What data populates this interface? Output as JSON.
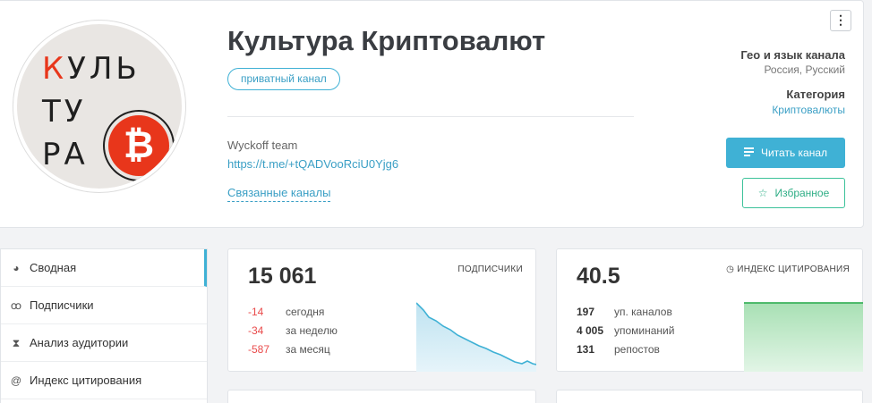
{
  "channel": {
    "title": "Культура Криптовалют",
    "badge": "приватный канал",
    "description": "Wyckoff team",
    "link": "https://t.me/+tQADVooRciU0Yjg6",
    "related": "Связанные каналы",
    "logo_lines": [
      "КУЛЬ",
      "ТУ",
      "РА"
    ],
    "logo_coin_symbol": "₿"
  },
  "info": {
    "geo_label": "Гео и язык канала",
    "geo_value": "Россия, Русский",
    "category_label": "Категория",
    "category_value": "Криптовалюты"
  },
  "buttons": {
    "read": "Читать канал",
    "favorite": "Избранное",
    "menu": "⋮"
  },
  "sidebar": {
    "items": [
      {
        "label": "Сводная",
        "icon": "dashboard-icon"
      },
      {
        "label": "Подписчики",
        "icon": "users-icon"
      },
      {
        "label": "Анализ аудитории",
        "icon": "hourglass-icon"
      },
      {
        "label": "Индекс цитирования",
        "icon": "at-icon"
      }
    ]
  },
  "subscribers": {
    "total": "15 061",
    "label": "ПОДПИСЧИКИ",
    "rows": [
      {
        "value": "-14",
        "label": "сегодня"
      },
      {
        "value": "-34",
        "label": "за неделю"
      },
      {
        "value": "-587",
        "label": "за месяц"
      }
    ]
  },
  "citation": {
    "total": "40.5",
    "label": "ИНДЕКС ЦИТИРОВАНИЯ",
    "rows": [
      {
        "value": "197",
        "label": "уп. каналов"
      },
      {
        "value": "4 005",
        "label": "упоминаний"
      },
      {
        "value": "131",
        "label": "репостов"
      }
    ]
  },
  "colors": {
    "accent": "#3fb1d5",
    "negative": "#e94b4b",
    "favorite": "#3cc29a",
    "logo_red": "#e8361b"
  }
}
